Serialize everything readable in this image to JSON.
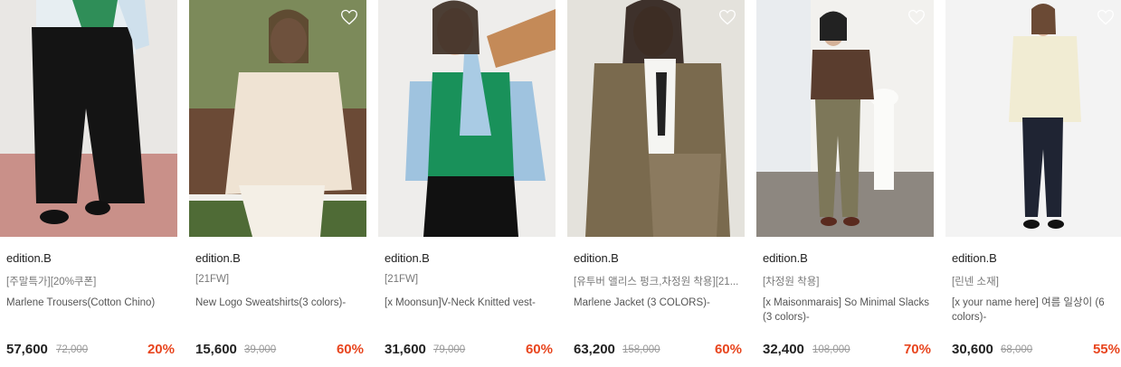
{
  "products": [
    {
      "brand": "edition.B",
      "tag": "[주말특가][20%쿠폰]",
      "name": "Marlene Trousers(Cotton Chino)",
      "price": "57,600",
      "original_price": "72,000",
      "discount": "20%",
      "has_wishlist_icon": false
    },
    {
      "brand": "edition.B",
      "tag": "[21FW]",
      "name": "New Logo Sweatshirts(3 colors)-",
      "price": "15,600",
      "original_price": "39,000",
      "discount": "60%",
      "has_wishlist_icon": true
    },
    {
      "brand": "edition.B",
      "tag": "[21FW]",
      "name": "[x Moonsun]V-Neck Knitted vest-",
      "price": "31,600",
      "original_price": "79,000",
      "discount": "60%",
      "has_wishlist_icon": false
    },
    {
      "brand": "edition.B",
      "tag": "[유투버 앨리스 펑크,차정원 착용][21...",
      "name": "Marlene Jacket (3 COLORS)-",
      "price": "63,200",
      "original_price": "158,000",
      "discount": "60%",
      "has_wishlist_icon": true
    },
    {
      "brand": "edition.B",
      "tag": "[차정원 착용]",
      "name": "[x Maisonmarais] So Minimal Slacks (3 colors)-",
      "price": "32,400",
      "original_price": "108,000",
      "discount": "70%",
      "has_wishlist_icon": true
    },
    {
      "brand": "edition.B",
      "tag": "[린넨 소재]",
      "name": "[x your name here] 여름 일상이 (6 colors)-",
      "price": "30,600",
      "original_price": "68,000",
      "discount": "55%",
      "has_wishlist_icon": true
    }
  ],
  "colors": {
    "discount": "#e8451e",
    "price": "#222222",
    "original_price": "#999999",
    "tag": "#777777"
  },
  "icons": {
    "wishlist": "heart-outline-icon"
  }
}
